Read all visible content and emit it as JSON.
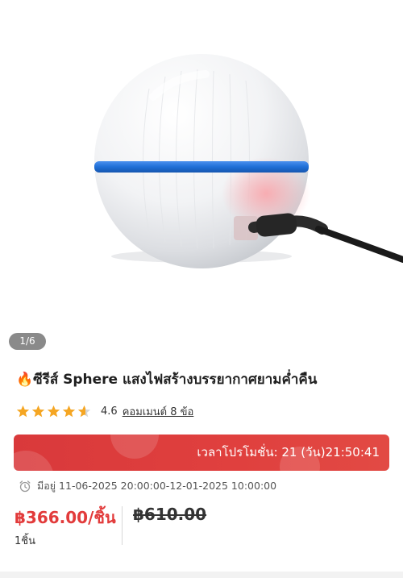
{
  "gallery": {
    "page_indicator": "1/6"
  },
  "product": {
    "title_icon": "fire-icon",
    "title": "🔥ซีรีส์ Sphere แสงไฟสร้างบรรยากาศยามค่ำคืน",
    "rating": {
      "stars": 4.6,
      "value_text": "4.6",
      "reviews_text": "คอมเมนต์ 8 ข้อ"
    }
  },
  "promo": {
    "countdown_text": "เวลาโปรโมชั่น: 21 (วัน)21:50:41",
    "period_text": "มีอยู่ 11-06-2025 20:00:00-12-01-2025 10:00:00"
  },
  "pricing": {
    "price_text": "฿366.00/ชิ้น",
    "unit_note": "1ชิ้น",
    "old_price_text": "฿610.00"
  },
  "colors": {
    "accent": "#e23b3b",
    "banner": "#d9393b",
    "star": "#f5a623",
    "band_blue": "#1f6fd6"
  }
}
